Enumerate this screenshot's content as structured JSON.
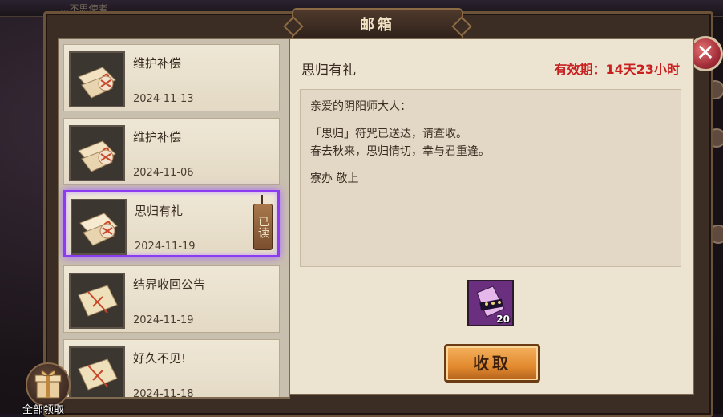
{
  "window": {
    "title": "邮箱"
  },
  "top_hint": "...不思使者",
  "mails": [
    {
      "title": "维护补偿",
      "date": "2024-11-13",
      "selected": false,
      "read": false
    },
    {
      "title": "维护补偿",
      "date": "2024-11-06",
      "selected": false,
      "read": false
    },
    {
      "title": "思归有礼",
      "date": "2024-11-19",
      "selected": true,
      "read": true,
      "read_label": "已读"
    },
    {
      "title": "结界收回公告",
      "date": "2024-11-19",
      "selected": false,
      "read": false
    },
    {
      "title": "好久不见!",
      "date": "2024-11-18",
      "selected": false,
      "read": false
    }
  ],
  "detail": {
    "title": "思归有礼",
    "expire": "有效期：14天23小时",
    "body_lines": [
      "亲爱的阴阳师大人：",
      "",
      "「思归」符咒已送达，请查收。",
      "春去秋来，思归情切，幸与君重逢。",
      "",
      "寮办 敬上"
    ],
    "reward": {
      "icon": "talisman-icon",
      "count": "20"
    },
    "claim_label": "收取"
  },
  "claim_all_label": "全部领取",
  "colors": {
    "selected_border": "#8b3cf0",
    "expire_text": "#c81f1f",
    "claim_button": "#e28a2f"
  }
}
